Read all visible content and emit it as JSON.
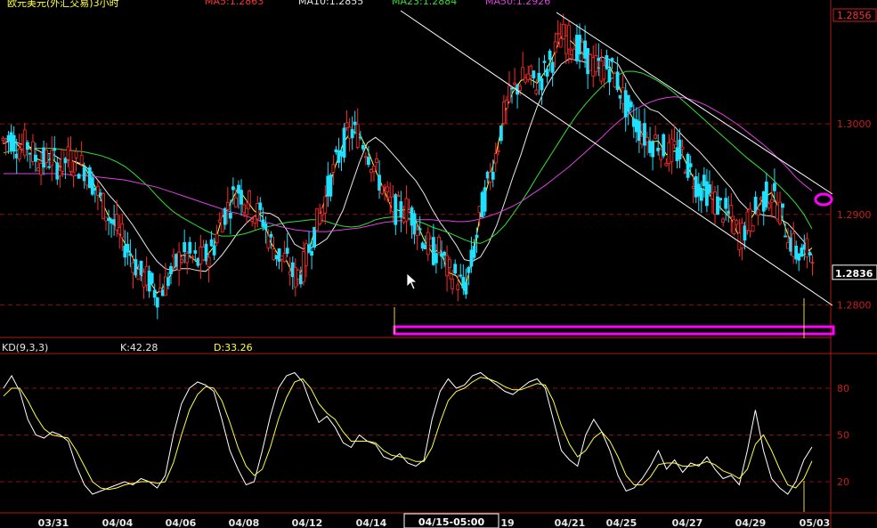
{
  "header": {
    "title": "欧元美元(外汇交易)3小时",
    "ma5": "MA5:1.2863",
    "ma10": "MA10:1.2855",
    "ma23": "MA23:1.2884",
    "ma50": "MA50:1.2926"
  },
  "colors": {
    "bg": "#000000",
    "grid": "#8a1010",
    "axis": "#b01a1a",
    "up": "#ff2a2a",
    "down": "#20e0ff",
    "ma5": "#ffff40",
    "ma10": "#e8e8e8",
    "ma23": "#30e030",
    "ma50": "#e040e0",
    "highlight": "#ff00ff",
    "trendline": "#ffffff"
  },
  "price_axis": {
    "top_value": "1.2856",
    "labels": [
      "1.3000",
      "1.2900",
      "1.2800"
    ],
    "current_value": "1.2836"
  },
  "indicator": {
    "name": "KD(9,3,3)",
    "k_label": "K:42.28",
    "d_label": "D:33.26",
    "axis_labels": [
      "80",
      "50",
      "20"
    ]
  },
  "time_axis": {
    "labels": [
      "03/31",
      "04/04",
      "04/06",
      "04/08",
      "04/12",
      "04/14",
      "19",
      "04/21",
      "04/25",
      "04/27",
      "04/29",
      "05/03"
    ],
    "cursor_label": "04/15-05:00"
  },
  "chart_data": [
    {
      "type": "candlestick",
      "title": "欧元美元(外汇交易)3小时",
      "ylim": [
        1.2765,
        1.3125
      ],
      "series": [
        {
          "name": "MA5",
          "values": [
            1.2982,
            1.2985,
            1.2974,
            1.2978,
            1.2962,
            1.2958,
            1.2962,
            1.2952,
            1.2962,
            1.2957,
            1.2953,
            1.2937,
            1.2917,
            1.2898,
            1.2885,
            1.2868,
            1.2852,
            1.2833,
            1.2827,
            1.2813,
            1.2822,
            1.2839,
            1.2855,
            1.2854,
            1.2847,
            1.2853,
            1.2864,
            1.2896,
            1.2911,
            1.2929,
            1.2916,
            1.2904,
            1.2898,
            1.287,
            1.2855,
            1.2849,
            1.283,
            1.2839,
            1.2868,
            1.2895,
            1.2923,
            1.2952,
            1.2978,
            1.2992,
            1.2989,
            1.2972,
            1.2949,
            1.2928,
            1.2907,
            1.2904,
            1.2906,
            1.2893,
            1.2872,
            1.2858,
            1.2861,
            1.2836,
            1.2832,
            1.2816,
            1.2851,
            1.2901,
            1.2936,
            1.297,
            1.3014,
            1.3035,
            1.3048,
            1.305,
            1.3045,
            1.3058,
            1.3075,
            1.3096,
            1.3093,
            1.3084,
            1.3074,
            1.3063,
            1.3061,
            1.3063,
            1.3045,
            1.3019,
            1.3004,
            1.2989,
            1.298,
            1.2981,
            1.2966,
            1.297,
            1.2965,
            1.2946,
            1.293,
            1.2926,
            1.2914,
            1.2904,
            1.2895,
            1.2875,
            1.2889,
            1.2903,
            1.2918,
            1.2924,
            1.2904,
            1.2878,
            1.2857,
            1.2855,
            1.2863
          ]
        },
        {
          "name": "MA10",
          "values": [
            1.2978,
            1.2982,
            1.2978,
            1.2975,
            1.2972,
            1.2967,
            1.2967,
            1.2961,
            1.296,
            1.2958,
            1.2954,
            1.2945,
            1.2934,
            1.2922,
            1.2912,
            1.29,
            1.2888,
            1.2874,
            1.286,
            1.2848,
            1.284,
            1.2838,
            1.284,
            1.284,
            1.2838,
            1.2837,
            1.2845,
            1.2855,
            1.2867,
            1.288,
            1.289,
            1.2898,
            1.2902,
            1.2901,
            1.2896,
            1.2883,
            1.2867,
            1.2862,
            1.2863,
            1.2867,
            1.2873,
            1.2887,
            1.2905,
            1.2931,
            1.2957,
            1.2979,
            1.2985,
            1.2978,
            1.2968,
            1.2958,
            1.2947,
            1.2937,
            1.2923,
            1.2906,
            1.2891,
            1.2879,
            1.2866,
            1.285,
            1.2848,
            1.2853,
            1.2868,
            1.2888,
            1.2914,
            1.2941,
            1.2966,
            1.2994,
            1.3019,
            1.3039,
            1.3054,
            1.3066,
            1.3072,
            1.307,
            1.3068,
            1.3069,
            1.3074,
            1.3071,
            1.3066,
            1.305,
            1.3035,
            1.3023,
            1.3016,
            1.3013,
            1.3005,
            1.2997,
            1.2987,
            1.2978,
            1.297,
            1.296,
            1.295,
            1.2939,
            1.2929,
            1.2915,
            1.2906,
            1.2902,
            1.2899,
            1.2898,
            1.2895,
            1.289,
            1.288,
            1.287,
            1.2855
          ]
        },
        {
          "name": "MA23",
          "values": [
            1.2968,
            1.297,
            1.2971,
            1.2972,
            1.2973,
            1.2973,
            1.2973,
            1.2972,
            1.2971,
            1.297,
            1.2969,
            1.2967,
            1.2965,
            1.2962,
            1.2958,
            1.2953,
            1.2946,
            1.2938,
            1.293,
            1.292,
            1.2911,
            1.2903,
            1.2897,
            1.2892,
            1.2887,
            1.2882,
            1.2878,
            1.2876,
            1.2876,
            1.2877,
            1.2879,
            1.2882,
            1.2885,
            1.2887,
            1.2889,
            1.2891,
            1.2892,
            1.2893,
            1.2894,
            1.2894,
            1.2892,
            1.2889,
            1.2887,
            1.2886,
            1.2887,
            1.289,
            1.2894,
            1.2896,
            1.2897,
            1.2897,
            1.2896,
            1.2893,
            1.289,
            1.2886,
            1.2883,
            1.288,
            1.2876,
            1.2872,
            1.2869,
            1.2868,
            1.2872,
            1.2879,
            1.2888,
            1.29,
            1.2913,
            1.2927,
            1.2942,
            1.2956,
            1.297,
            1.2984,
            1.2998,
            1.3011,
            1.3022,
            1.3032,
            1.3041,
            1.3049,
            1.3054,
            1.3058,
            1.3058,
            1.3056,
            1.3052,
            1.3047,
            1.3041,
            1.3034,
            1.3026,
            1.3018,
            1.301,
            1.3002,
            1.2994,
            1.2986,
            1.2978,
            1.297,
            1.2962,
            1.2955,
            1.2948,
            1.294,
            1.2931,
            1.2922,
            1.2912,
            1.29,
            1.2884
          ]
        },
        {
          "name": "MA50",
          "values": [
            1.2945,
            1.2945,
            1.2945,
            1.2945,
            1.2945,
            1.2945,
            1.2945,
            1.2945,
            1.2944,
            1.2943,
            1.2943,
            1.2942,
            1.2941,
            1.294,
            1.2939,
            1.2938,
            1.2936,
            1.2934,
            1.2932,
            1.293,
            1.2927,
            1.2924,
            1.2921,
            1.2918,
            1.2915,
            1.2912,
            1.2909,
            1.2906,
            1.2903,
            1.2901,
            1.2898,
            1.2895,
            1.2892,
            1.289,
            1.2887,
            1.2885,
            1.2883,
            1.2882,
            1.2881,
            1.2881,
            1.2881,
            1.2882,
            1.2883,
            1.2884,
            1.2885,
            1.2887,
            1.2889,
            1.2891,
            1.2892,
            1.2893,
            1.2894,
            1.2894,
            1.2894,
            1.2894,
            1.2893,
            1.2893,
            1.2892,
            1.2892,
            1.2893,
            1.2895,
            1.2898,
            1.2901,
            1.2905,
            1.2909,
            1.2914,
            1.292,
            1.2926,
            1.2932,
            1.2939,
            1.2946,
            1.2953,
            1.2961,
            1.2969,
            1.2977,
            1.2985,
            1.2994,
            1.3002,
            1.3009,
            1.3015,
            1.302,
            1.3024,
            1.3027,
            1.3029,
            1.303,
            1.3029,
            1.3027,
            1.3024,
            1.302,
            1.3015,
            1.301,
            1.3004,
            1.2998,
            1.2991,
            1.2984,
            1.2977,
            1.2969,
            1.296,
            1.2951,
            1.2941,
            1.2933,
            1.2926
          ]
        }
      ]
    },
    {
      "type": "line",
      "title": "KD(9,3,3)",
      "ylim": [
        0,
        100
      ],
      "series": [
        {
          "name": "K",
          "values": [
            80,
            88,
            78,
            60,
            50,
            48,
            52,
            50,
            46,
            30,
            18,
            12,
            14,
            16,
            18,
            20,
            18,
            22,
            20,
            16,
            24,
            50,
            70,
            80,
            84,
            82,
            78,
            60,
            40,
            28,
            18,
            20,
            40,
            62,
            80,
            88,
            90,
            84,
            70,
            58,
            62,
            55,
            45,
            42,
            50,
            46,
            44,
            36,
            34,
            38,
            32,
            30,
            34,
            60,
            78,
            86,
            80,
            82,
            88,
            90,
            86,
            82,
            78,
            76,
            80,
            84,
            86,
            80,
            60,
            40,
            34,
            30,
            50,
            60,
            52,
            40,
            24,
            14,
            16,
            22,
            30,
            40,
            28,
            34,
            26,
            32,
            30,
            36,
            28,
            22,
            24,
            18,
            40,
            66,
            40,
            22,
            16,
            12,
            20,
            34,
            42.28
          ]
        },
        {
          "name": "D",
          "values": [
            75,
            80,
            80,
            72,
            62,
            54,
            50,
            49,
            48,
            40,
            30,
            20,
            16,
            15,
            16,
            18,
            19,
            20,
            20,
            19,
            20,
            32,
            50,
            66,
            76,
            81,
            80,
            72,
            58,
            42,
            30,
            24,
            28,
            42,
            60,
            74,
            84,
            86,
            80,
            70,
            64,
            60,
            52,
            46,
            46,
            46,
            45,
            40,
            37,
            36,
            35,
            33,
            33,
            42,
            58,
            72,
            78,
            80,
            84,
            87,
            86,
            84,
            81,
            79,
            79,
            81,
            83,
            82,
            72,
            56,
            44,
            36,
            40,
            48,
            52,
            46,
            36,
            24,
            18,
            18,
            23,
            31,
            32,
            32,
            30,
            30,
            31,
            33,
            31,
            27,
            25,
            22,
            28,
            44,
            50,
            40,
            28,
            18,
            16,
            22,
            33.26
          ]
        }
      ]
    }
  ]
}
